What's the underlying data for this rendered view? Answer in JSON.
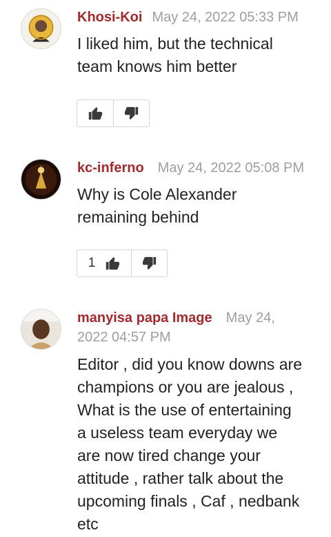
{
  "comments": [
    {
      "author": "Khosi-Koi",
      "date": "May 24, 2022 05:33 PM",
      "lines": [
        "I liked him, but the technical",
        "team knows him better"
      ],
      "upvotes": ""
    },
    {
      "author": "kc-inferno",
      "date": "May 24, 2022 05:08 PM",
      "lines": [
        "Why is Cole Alexander",
        "remaining behind"
      ],
      "upvotes": "1"
    },
    {
      "author": "manyisa papa Image",
      "date_part1": "May 24,",
      "date_part2": "2022 04:57 PM",
      "lines": [
        "Editor , did you know downs are",
        "champions or you are jealous ,",
        "What is the use of entertaining",
        "a useless team everyday we",
        "are now tired change your",
        "attitude , rather talk about the",
        "upcoming finals , Caf , nedbank",
        "etc"
      ]
    }
  ],
  "icons": {
    "thumbs_up": "thumbs-up-icon",
    "thumbs_down": "thumbs-down-icon"
  },
  "colors": {
    "author": "#a5292c",
    "date": "#9e9e9e",
    "icon": "#3a3a3a"
  }
}
